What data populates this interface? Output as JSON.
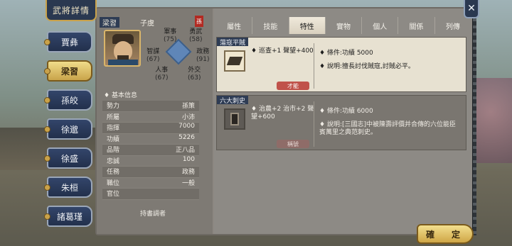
{
  "window_title": "武將詳情",
  "sidebar": {
    "items": [
      {
        "label": "賈彝",
        "active": false
      },
      {
        "label": "梁習",
        "active": true
      },
      {
        "label": "孫皎",
        "active": false
      },
      {
        "label": "徐邈",
        "active": false
      },
      {
        "label": "徐盛",
        "active": false
      },
      {
        "label": "朱桓",
        "active": false
      },
      {
        "label": "諸葛瑾",
        "active": false
      }
    ]
  },
  "general": {
    "name": "梁習",
    "courtesy": "子虞",
    "seal_char": "孫",
    "stats": {
      "military": {
        "label": "軍事",
        "value": "(75)"
      },
      "valor": {
        "label": "勇武",
        "value": "(58)"
      },
      "intel": {
        "label": "智謀",
        "value": "(67)"
      },
      "politics": {
        "label": "政務",
        "value": "(91)"
      },
      "personnel": {
        "label": "人事",
        "value": "(67)"
      },
      "diplomacy": {
        "label": "外交",
        "value": "(63)"
      }
    }
  },
  "basic_info": {
    "header": "基本信息",
    "rows": [
      {
        "k": "勢力",
        "v": "孫策"
      },
      {
        "k": "所屬",
        "v": "小沛"
      },
      {
        "k": "指揮",
        "v": "7000"
      },
      {
        "k": "功績",
        "v": "5226"
      },
      {
        "k": "品階",
        "v": "正八品"
      },
      {
        "k": "忠誠",
        "v": "100"
      },
      {
        "k": "任務",
        "v": "政務"
      },
      {
        "k": "職位",
        "v": "一般"
      },
      {
        "k": "官位",
        "v": ""
      }
    ],
    "holder": "持書調者"
  },
  "tabs": [
    {
      "label": "屬性",
      "active": false
    },
    {
      "label": "技能",
      "active": false
    },
    {
      "label": "特性",
      "active": true
    },
    {
      "label": "實物",
      "active": false
    },
    {
      "label": "個人",
      "active": false
    },
    {
      "label": "關係",
      "active": false
    },
    {
      "label": "列傳",
      "active": false
    }
  ],
  "traits": [
    {
      "title": "蕩寇平賊",
      "effect": "巡查+1 聲望+400",
      "tag": "才能",
      "condition": "條件:功績 5000",
      "desc": "說明:擅長討伐賊寇,討賊必平。"
    },
    {
      "title": "六大刺史",
      "effect": "治農+2 治市+2 聲望+600",
      "tag": "稱號",
      "condition": "條件:功績 6000",
      "desc": "說明:[三國志]中被陳壽評價并合傳的六位能臣賓萬里之典范刺史。"
    }
  ],
  "confirm_label": "確　定",
  "close_icon": "✕"
}
